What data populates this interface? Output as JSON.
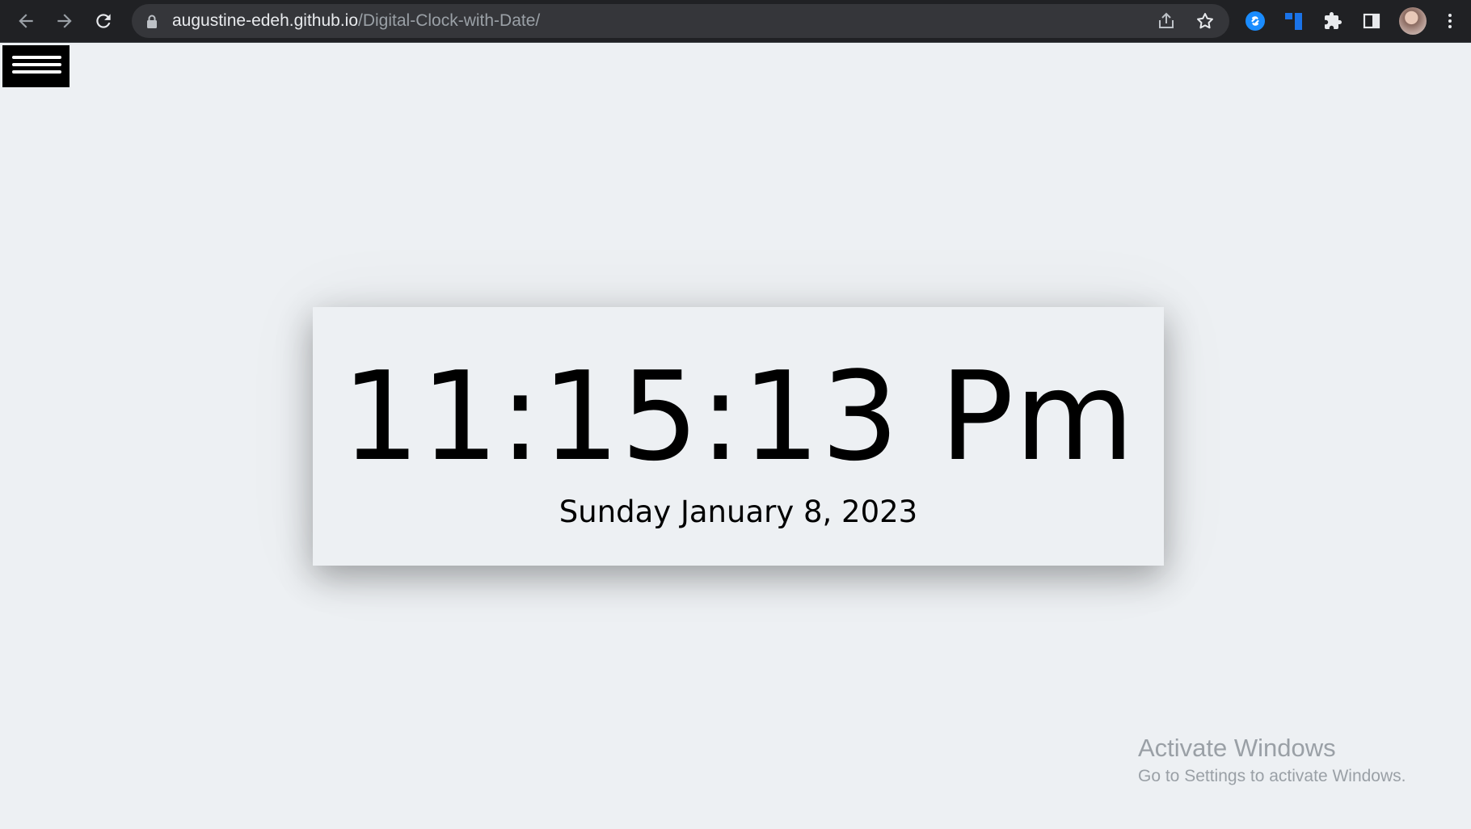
{
  "browser": {
    "url_host": "augustine-edeh.github.io",
    "url_path": "/Digital-Clock-with-Date/",
    "icons": [
      "back-arrow-icon",
      "forward-arrow-icon",
      "reload-icon",
      "lock-icon",
      "share-icon",
      "star-icon",
      "shazam-extension-icon",
      "trello-extension-icon",
      "puzzle-extensions-icon",
      "side-panel-icon",
      "avatar",
      "more-vert-icon"
    ],
    "colors": {
      "toolbar": "#202124",
      "omnibox": "#35363a",
      "accent": "#1a73e8"
    }
  },
  "page": {
    "menu_icon": "hamburger-menu-icon",
    "clock": {
      "time": "11:15:13 Pm",
      "date": "Sunday January 8, 2023"
    },
    "colors": {
      "background": "#edf0f3",
      "menu_button": "#000000",
      "text": "#000000"
    }
  },
  "watermark": {
    "title": "Activate Windows",
    "subtitle": "Go to Settings to activate Windows."
  }
}
